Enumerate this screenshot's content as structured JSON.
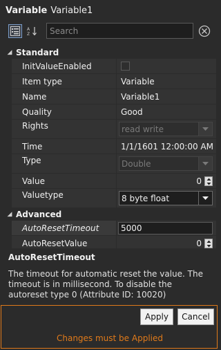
{
  "title": {
    "label": "Variable",
    "name": "Variable1"
  },
  "toolbar": {
    "search_placeholder": "Search"
  },
  "categories": {
    "standard": "Standard",
    "advanced": "Advanced"
  },
  "properties": {
    "init_value_enabled": {
      "name": "InitValueEnabled",
      "checked": false
    },
    "item_type": {
      "name": "Item type",
      "value": "Variable"
    },
    "name": {
      "name": "Name",
      "value": "Variable1"
    },
    "quality": {
      "name": "Quality",
      "value": "Good"
    },
    "rights": {
      "name": "Rights",
      "value": "read write"
    },
    "time": {
      "name": "Time",
      "value": "1/1/1601 12:00:00 AM"
    },
    "type": {
      "name": "Type",
      "value": "Double"
    },
    "value": {
      "name": "Value",
      "value": "0"
    },
    "valuetype": {
      "name": "Valuetype",
      "value": "8 byte float"
    },
    "auto_reset_timeout": {
      "name": "AutoResetTimeout",
      "value": "5000"
    },
    "auto_reset_value": {
      "name": "AutoResetValue",
      "value": "0"
    }
  },
  "description": {
    "title": "AutoResetTimeout",
    "text": "The timeout for automatic reset the value. The timeout is in millisecond. To disable the autoreset type  0 (Attribute ID: 10020)"
  },
  "footer": {
    "apply_label": "Apply",
    "cancel_label": "Cancel",
    "warning": "Changes must be Applied"
  },
  "colors": {
    "accent": "#e07a1a",
    "background": "#2b2b2b",
    "row": "#333333"
  }
}
